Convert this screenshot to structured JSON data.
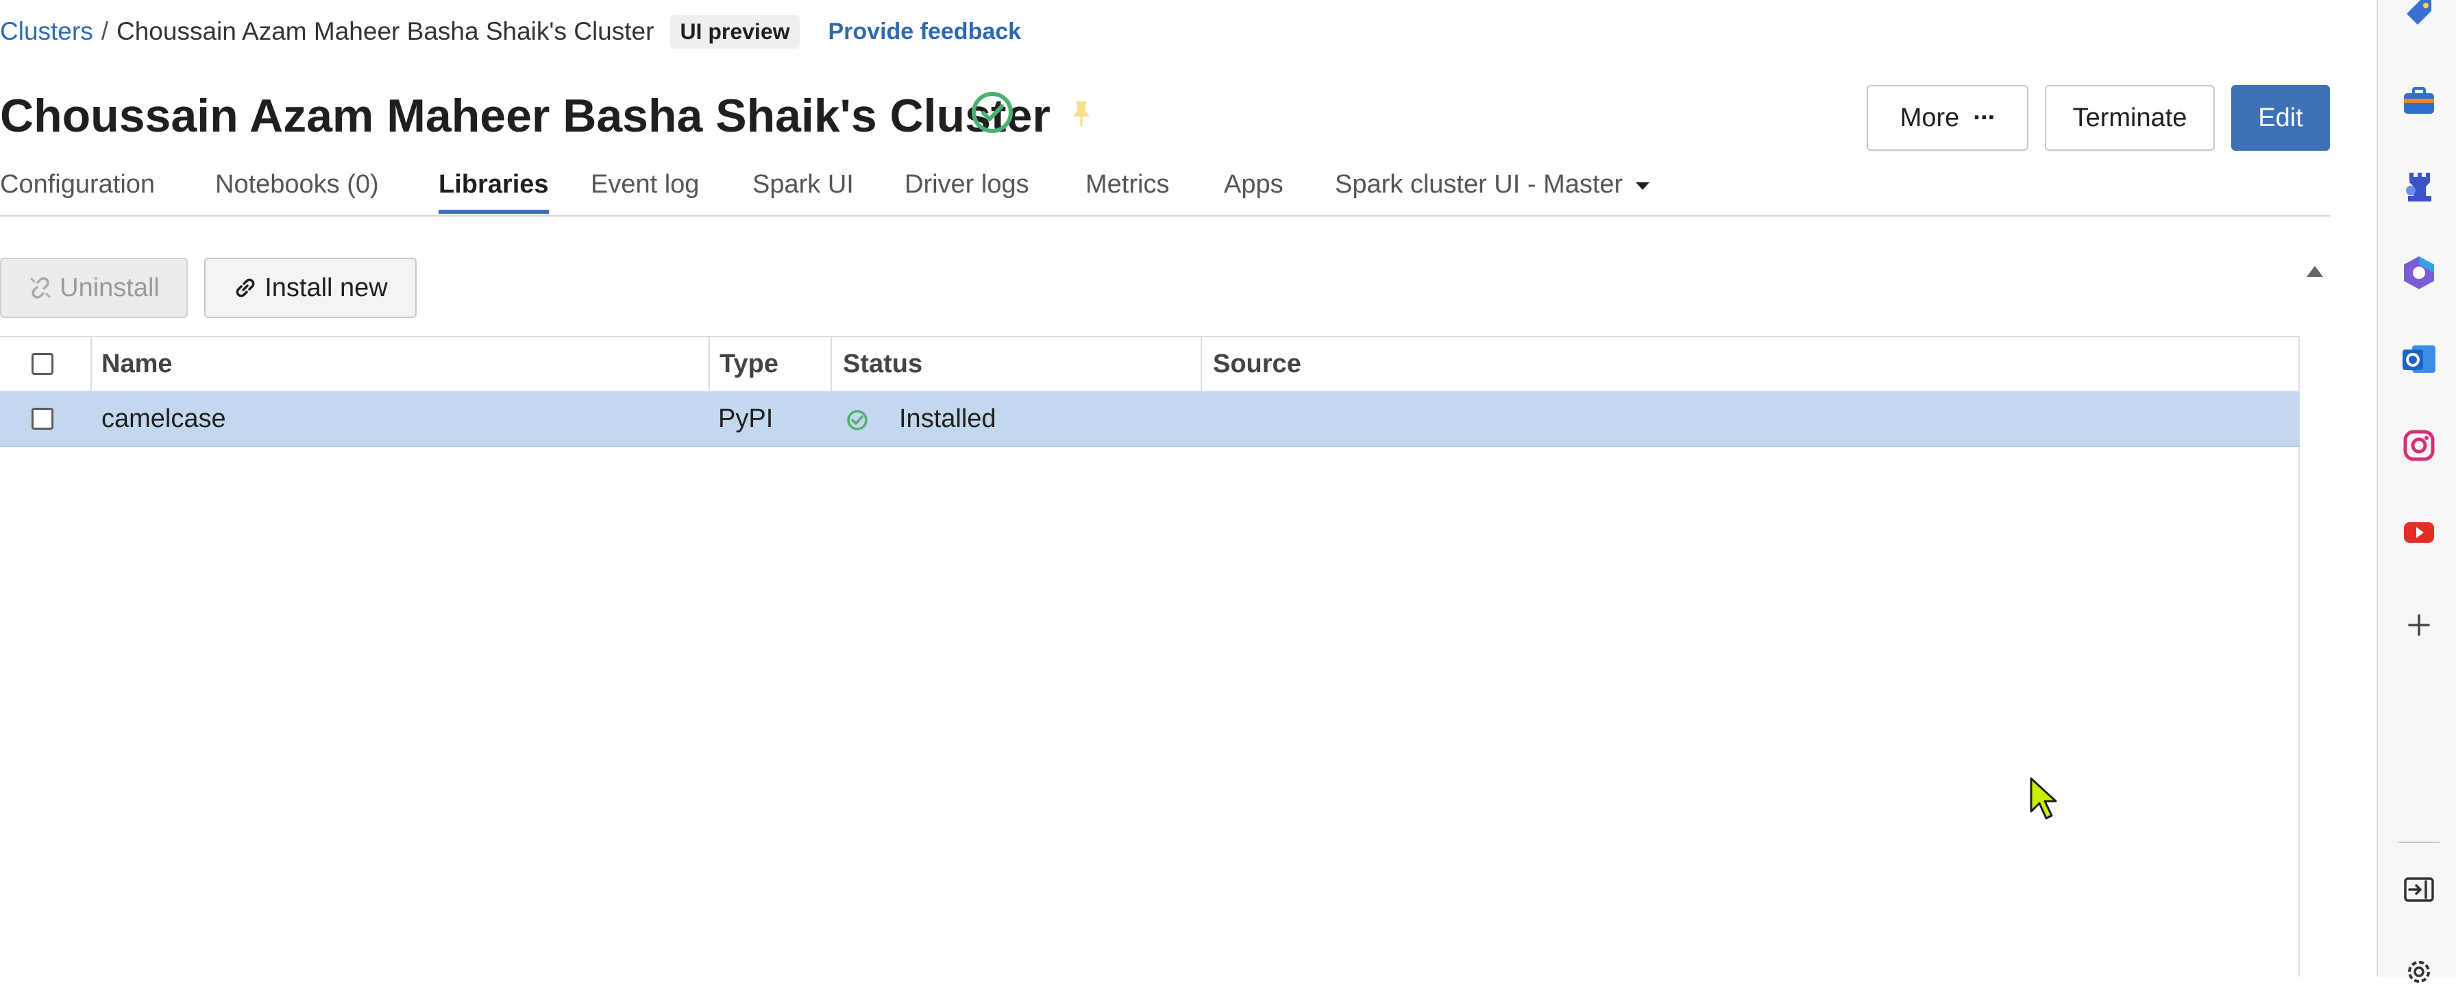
{
  "breadcrumb": {
    "root": "Clusters",
    "separator": "/",
    "current": "Choussain Azam Maheer Basha Shaik's Cluster",
    "badge": "UI preview",
    "feedback": "Provide feedback"
  },
  "header": {
    "title": "Choussain Azam Maheer Basha Shaik's Cluster",
    "status_icon": "check-circle-icon",
    "more_label": "More",
    "more_dots": "···",
    "terminate_label": "Terminate",
    "edit_label": "Edit"
  },
  "tabs": [
    {
      "label": "Configuration"
    },
    {
      "label": "Notebooks (0)"
    },
    {
      "label": "Libraries",
      "active": true
    },
    {
      "label": "Event log"
    },
    {
      "label": "Spark UI"
    },
    {
      "label": "Driver logs"
    },
    {
      "label": "Metrics"
    },
    {
      "label": "Apps"
    },
    {
      "label": "Spark cluster UI - Master"
    }
  ],
  "actions": {
    "uninstall_label": "Uninstall",
    "install_label": "Install new"
  },
  "table": {
    "columns": [
      "Name",
      "Type",
      "Status",
      "Source"
    ],
    "rows": [
      {
        "name": "camelcase",
        "type": "PyPI",
        "status": "Installed",
        "source": ""
      }
    ]
  },
  "colors": {
    "accent": "#3c71b5",
    "selected_row": "#c3d8ee",
    "status_green": "#4caf72"
  }
}
